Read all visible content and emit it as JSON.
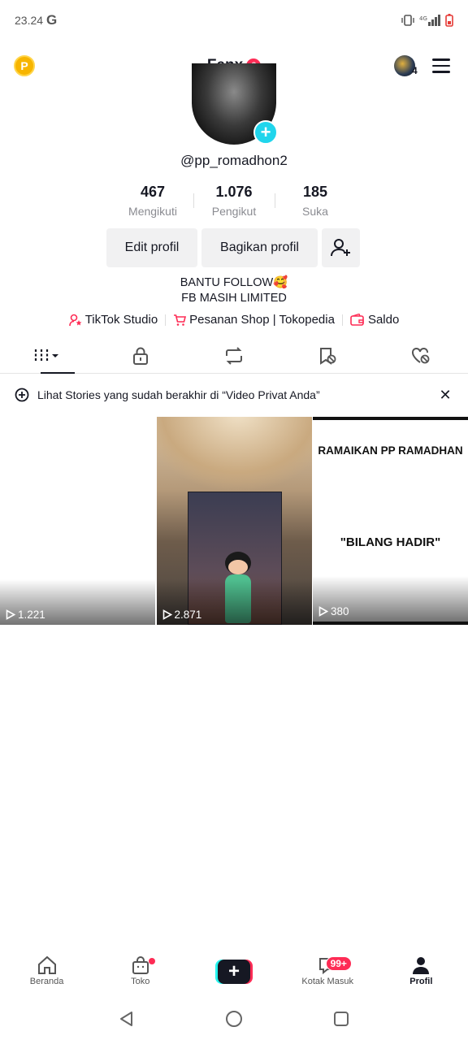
{
  "status_bar": {
    "time": "23.24",
    "google_icon": "G"
  },
  "header": {
    "title": "Fenx",
    "title_badge": "6",
    "points_icon": "P",
    "account_count": "4"
  },
  "profile": {
    "username": "@pp_romadhon2",
    "stats": [
      {
        "value": "467",
        "label": "Mengikuti"
      },
      {
        "value": "1.076",
        "label": "Pengikut"
      },
      {
        "value": "185",
        "label": "Suka"
      }
    ],
    "edit_label": "Edit profil",
    "share_label": "Bagikan profil",
    "bio_line1": "BANTU FOLLOW🥰",
    "bio_line2": "FB MASIH LIMITED",
    "links": {
      "studio": "TikTok Studio",
      "shop": "Pesanan Shop | Tokopedia",
      "balance": "Saldo"
    }
  },
  "tabs": [
    "videos-grid-icon",
    "lock-icon",
    "repost-icon",
    "saved-icon",
    "liked-icon"
  ],
  "stories_banner": {
    "text": "Lihat Stories yang sudah berakhir di “Video Privat Anda”"
  },
  "videos": [
    {
      "views": "1.221"
    },
    {
      "views": "2.871"
    },
    {
      "views": "380",
      "title": "RAMAIKAN PP RAMADHAN",
      "subtitle": "\"BILANG HADIR\""
    }
  ],
  "bottom_nav": {
    "home": "Beranda",
    "shop": "Toko",
    "inbox": "Kotak Masuk",
    "inbox_badge": "99+",
    "profile": "Profil"
  },
  "colors": {
    "accent": "#fe2c55",
    "cyan": "#20d5ec",
    "text": "#161823"
  }
}
